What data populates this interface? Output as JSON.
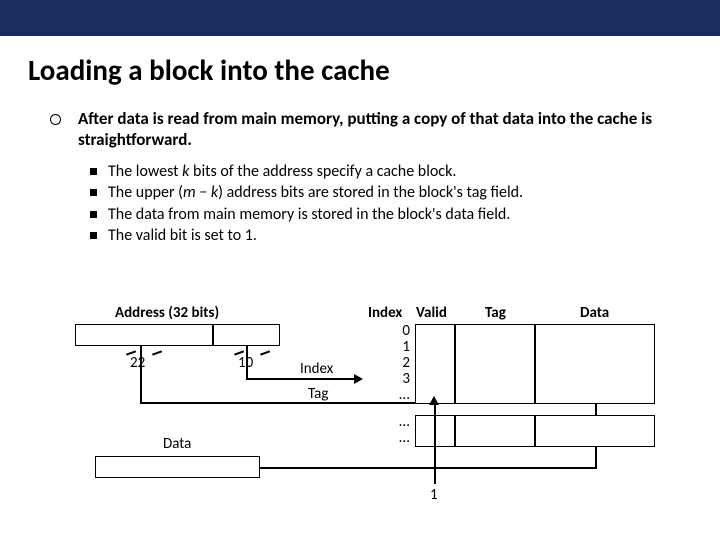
{
  "title": "Loading a block into the cache",
  "main_bullet": "After data is read from main memory, putting a copy of that data into the cache is straightforward.",
  "sub_bullets": [
    {
      "pre": "The lowest ",
      "var": "k",
      "post": " bits of the address specify a cache block."
    },
    {
      "text_html": "upper_mk"
    },
    {
      "text": "The data from main memory is stored in the block's data field."
    },
    {
      "text": "The valid bit is set to 1."
    }
  ],
  "diagram": {
    "address_label": "Address (32 bits)",
    "tag_bits": "22",
    "index_bits": "10",
    "index_label": "Index",
    "tag_label": "Tag",
    "data_label": "Data",
    "headers": {
      "index": "Index",
      "valid": "Valid",
      "tag": "Tag",
      "data": "Data"
    },
    "row_labels": [
      "0",
      "1",
      "2",
      "3",
      "...",
      "...",
      "..."
    ],
    "valid_out": "1"
  }
}
